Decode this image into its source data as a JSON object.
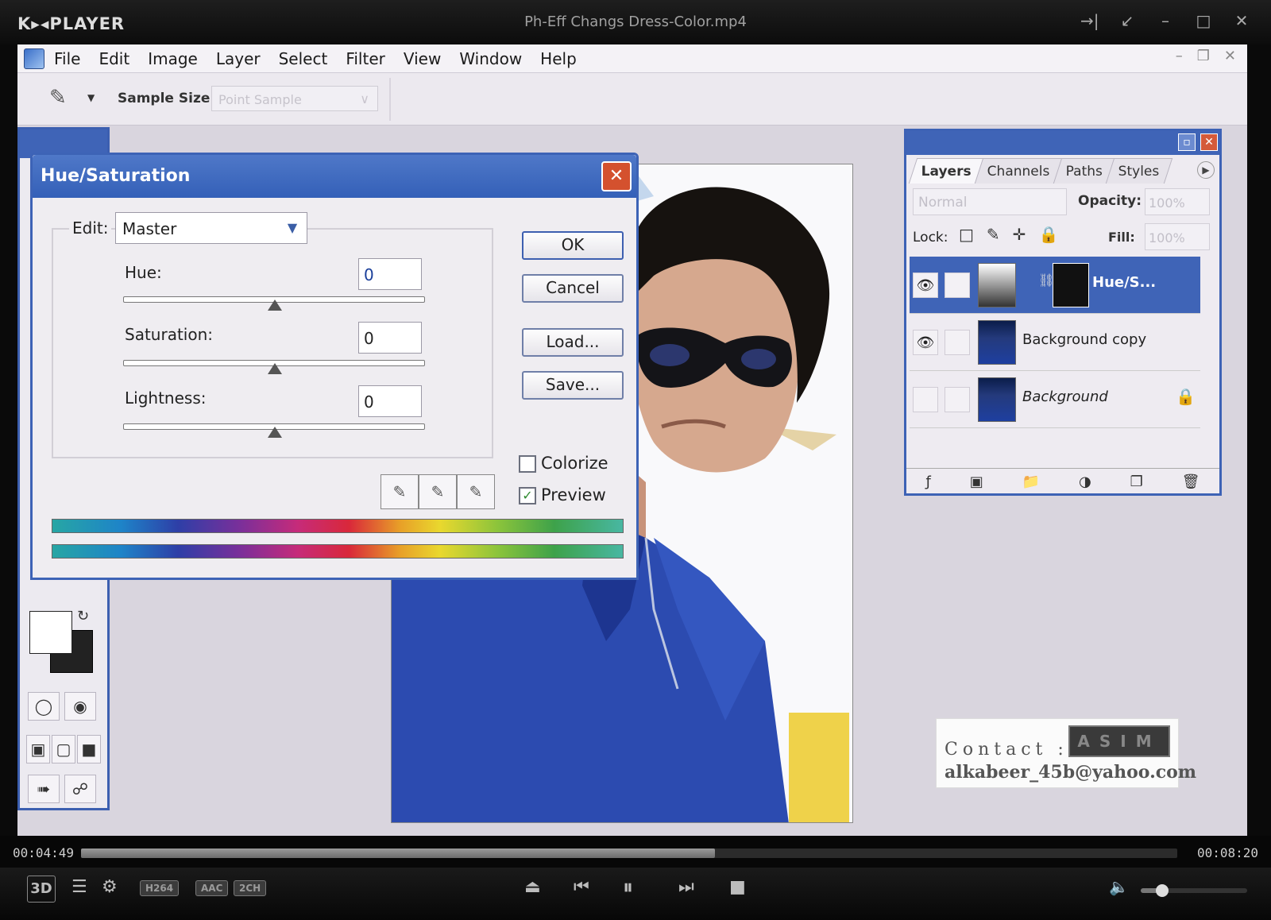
{
  "player": {
    "logo": "K▸◂PLAYER",
    "video_title": "Ph-Eff Changs Dress-Color.mp4",
    "window_controls": [
      "→|",
      "↙",
      "–",
      "□",
      "✕"
    ],
    "time_current": "00:04:49",
    "time_total": "00:08:20",
    "progress": 0.578,
    "volume": 0.2,
    "btn_3d": "3D",
    "badges": [
      "H264",
      "AAC",
      "2CH"
    ],
    "icons": {
      "playlist": "☰",
      "settings": "⚙",
      "eject": "⏏",
      "prev": "⏮",
      "pause": "⏸",
      "next": "⏭",
      "stop": "■",
      "volume": "🔈"
    }
  },
  "photoshop": {
    "menu": [
      "File",
      "Edit",
      "Image",
      "Layer",
      "Select",
      "Filter",
      "View",
      "Window",
      "Help"
    ],
    "doc_controls": [
      "–",
      "❐",
      "✕"
    ],
    "options_bar": {
      "sample_size_label": "Sample Size:",
      "sample_size_value": "Point Sample"
    },
    "contact": {
      "label": "Contact :",
      "email": "alkabeer_45b@yahoo.com",
      "logo_text": "ASIM"
    }
  },
  "layers_panel": {
    "tabs": [
      "Layers",
      "Channels",
      "Paths",
      "Styles"
    ],
    "blend_mode": "Normal",
    "opacity_label": "Opacity:",
    "opacity_value": "100%",
    "lock_label": "Lock:",
    "fill_label": "Fill:",
    "fill_value": "100%",
    "layers": [
      {
        "name": "Hue/S...",
        "visible": true,
        "selected": true
      },
      {
        "name": "Background copy",
        "visible": true,
        "selected": false
      },
      {
        "name": "Background",
        "visible": false,
        "selected": false,
        "locked": true
      }
    ]
  },
  "dialog": {
    "title": "Hue/Saturation",
    "edit_label": "Edit:",
    "edit_value": "Master",
    "hue_label": "Hue:",
    "hue_value": "0",
    "saturation_label": "Saturation:",
    "saturation_value": "0",
    "lightness_label": "Lightness:",
    "lightness_value": "0",
    "buttons": {
      "ok": "OK",
      "cancel": "Cancel",
      "load": "Load...",
      "save": "Save..."
    },
    "colorize_label": "Colorize",
    "colorize_checked": false,
    "preview_label": "Preview",
    "preview_checked": true
  },
  "colors": {
    "title_blue": "#3f64b7",
    "shirt_blue": "#2546a8",
    "close_red": "#d4512e"
  }
}
